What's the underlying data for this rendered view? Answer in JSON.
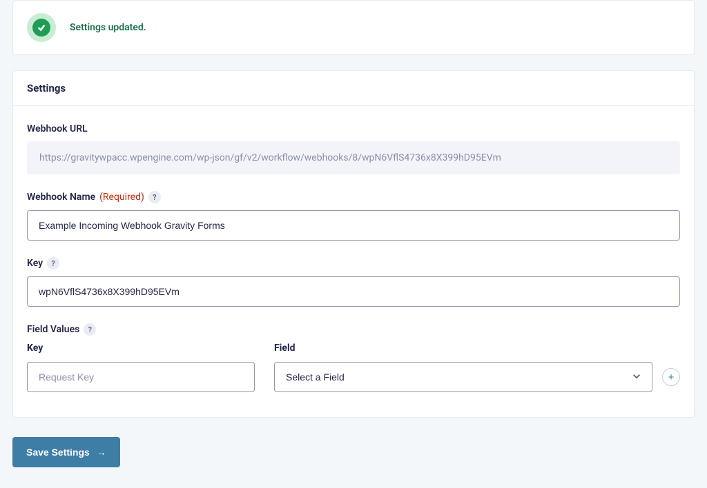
{
  "alert": {
    "message": "Settings updated."
  },
  "panel": {
    "title": "Settings"
  },
  "webhook_url": {
    "label": "Webhook URL",
    "value": "https://gravitywpacc.wpengine.com/wp-json/gf/v2/workflow/webhooks/8/wpN6VflS4736x8X399hD95EVm"
  },
  "webhook_name": {
    "label": "Webhook Name",
    "required_text": "(Required)",
    "value": "Example Incoming Webhook Gravity Forms"
  },
  "key": {
    "label": "Key",
    "value": "wpN6VflS4736x8X399hD95EVm"
  },
  "field_values": {
    "label": "Field Values",
    "key_column": "Key",
    "field_column": "Field",
    "key_placeholder": "Request Key",
    "select_placeholder": "Select a Field"
  },
  "help": "?",
  "save_button": "Save Settings"
}
